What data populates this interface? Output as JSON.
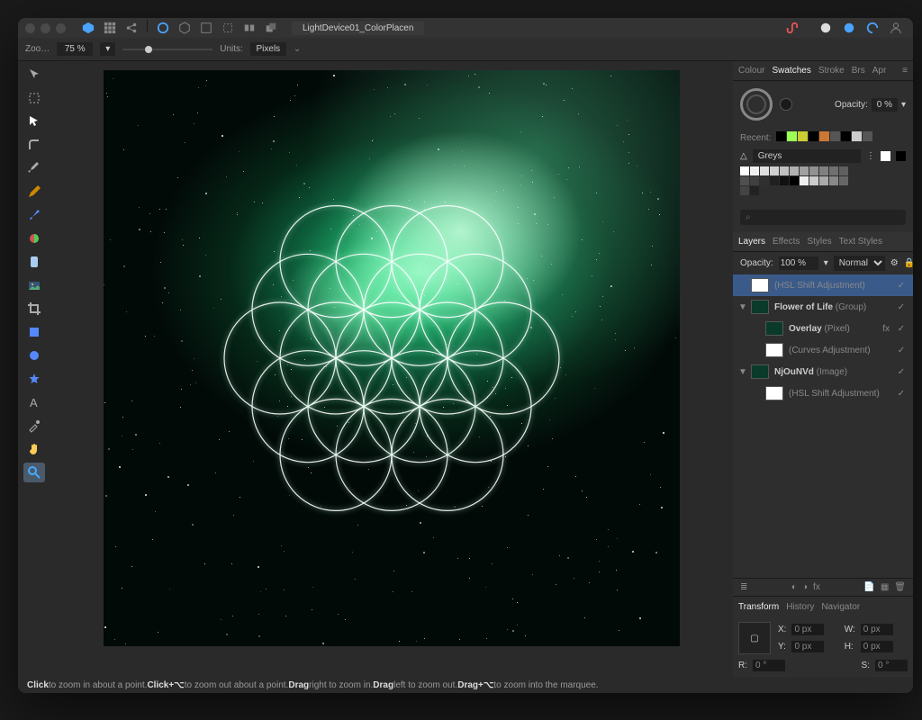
{
  "document": {
    "tab_name": "LightDevice01_ColorPlacen"
  },
  "context": {
    "zoom_label": "Zoo…",
    "zoom_value": "75 %",
    "units_label": "Units:",
    "units_value": "Pixels"
  },
  "color_panel": {
    "tabs": [
      "Colour",
      "Swatches",
      "Stroke",
      "Brs",
      "Apr"
    ],
    "active_tab": "Swatches",
    "opacity_label": "Opacity:",
    "opacity_value": "0 %",
    "recent_label": "Recent:",
    "recent_colors": [
      "#000000",
      "#9bff55",
      "#cccc33",
      "#000000",
      "#cc7733",
      "#555555",
      "#000000",
      "#cccccc",
      "#555555"
    ],
    "palette_name": "Greys",
    "greys": [
      "#ffffff",
      "#f0f0f0",
      "#e0e0e0",
      "#d0d0d0",
      "#c0c0c0",
      "#b0b0b0",
      "#a0a0a0",
      "#909090",
      "#808080",
      "#707070",
      "#606060",
      "#505050",
      "#404040",
      "#303030",
      "#202020",
      "#101010",
      "#000000",
      "#eeeeee",
      "#cccccc",
      "#aaaaaa",
      "#888888",
      "#666666",
      "#444444",
      "#222222"
    ]
  },
  "layers_panel": {
    "tabs": [
      "Layers",
      "Effects",
      "Styles",
      "Text Styles"
    ],
    "active_tab": "Layers",
    "opacity_label": "Opacity:",
    "opacity_value": "100 %",
    "blend_mode": "Normal",
    "layers": [
      {
        "name": "",
        "type": "(HSL Shift Adjustment)",
        "selected": true,
        "indent": 0,
        "disc": "",
        "thumb": "light",
        "fx": false
      },
      {
        "name": "Flower of Life",
        "type": "(Group)",
        "selected": false,
        "indent": 0,
        "disc": "▼",
        "thumb": "dark",
        "fx": false
      },
      {
        "name": "Overlay",
        "type": "(Pixel)",
        "selected": false,
        "indent": 1,
        "disc": "",
        "thumb": "dark",
        "fx": true
      },
      {
        "name": "",
        "type": "(Curves Adjustment)",
        "selected": false,
        "indent": 1,
        "disc": "",
        "thumb": "light",
        "fx": false
      },
      {
        "name": "NjOuNVd",
        "type": "(Image)",
        "selected": false,
        "indent": 0,
        "disc": "▼",
        "thumb": "dark",
        "fx": false
      },
      {
        "name": "",
        "type": "(HSL Shift Adjustment)",
        "selected": false,
        "indent": 1,
        "disc": "",
        "thumb": "light",
        "fx": false
      }
    ]
  },
  "transform": {
    "tabs": [
      "Transform",
      "History",
      "Navigator"
    ],
    "active_tab": "Transform",
    "x_label": "X:",
    "x": "0 px",
    "y_label": "Y:",
    "y": "0 px",
    "w_label": "W:",
    "w": "0 px",
    "h_label": "H:",
    "h": "0 px",
    "r_label": "R:",
    "r": "0 °",
    "s_label": "S:",
    "s": "0 °"
  },
  "status": {
    "parts": [
      "Click",
      " to zoom in about a point. ",
      "Click+⌥",
      " to zoom out about a point. ",
      "Drag",
      " right to zoom in. ",
      "Drag",
      " left to zoom out. ",
      "Drag+⌥",
      " to zoom into the marquee."
    ]
  },
  "fx_label": "fx"
}
